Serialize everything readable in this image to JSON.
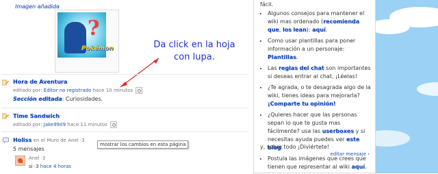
{
  "image_caption": "Imagen añadida",
  "image_alt": "Pokémon",
  "annotation": {
    "line1": "Da click en la hoja",
    "line2": "con lupa."
  },
  "entries": [
    {
      "title": "Hora de Aventura",
      "prefix": "editado por",
      "user": "Editor no registrado",
      "time": "hace 10 minutos",
      "summary_link": "Sección editada",
      "summary_text": ": Curiosidades."
    },
    {
      "title": "Time Sandwich",
      "prefix": "editado por",
      "user": "Jake9909",
      "time": "hace 11 minutos"
    }
  ],
  "thread": {
    "title": "Holiss",
    "in_text": "en el",
    "wall": "Muro de Anel ·3",
    "count": "5 mensajes",
    "reply_user": "Anel ·3",
    "reply_text": "si ·3",
    "reply_time": "hace 4 horas"
  },
  "tooltip": "mostrar los cambios en esta página",
  "sidebar": {
    "intro_tail": "fácil.",
    "items": [
      {
        "pre": "Algunos consejos para mantener el wiki mas ordenado (",
        "b1": "recomienda",
        "mid1": " ",
        "b2": "que",
        "mid2": ", ",
        "b3": "los",
        "mid3": " ",
        "b4": "lean",
        "mid4": "): ",
        "link": "aquí",
        "post": "."
      },
      {
        "pre": "Como usar plantillas para poner información a un personaje: ",
        "link": "Plantillas",
        "post": "."
      },
      {
        "pre": "Las ",
        "b1": "reglas",
        "mid1": " ",
        "b2": "del",
        "mid2": " ",
        "b3": "chat",
        "post": " son importantes si deseas entrar al chat, ¡Léelas!"
      },
      {
        "pre": "¿Te agrada, o te desagrada algo de la wiki, tienes ideas para mejorarla? ",
        "b1": "¡Comparte",
        "mid1": " ",
        "b2": "tu",
        "mid2": " ",
        "b3": "opinión!"
      },
      {
        "pre": "¿Quieres hacer que las personas sepan lo que te gusta mas fácilmente? usa las ",
        "b1": "userboxes",
        "mid1": " y si necesitas ayuda puedes ver ",
        "b2": "este",
        "mid2": " ",
        "b3": "blog",
        "post": "."
      },
      {
        "pre": "Postula las imágenes que crees que tienen que representar al wiki ",
        "link": "aquí",
        "post": "."
      }
    ],
    "closing": "y, sobre todo ¡Diviértete!",
    "edit_message": "editar mensaje ›"
  }
}
